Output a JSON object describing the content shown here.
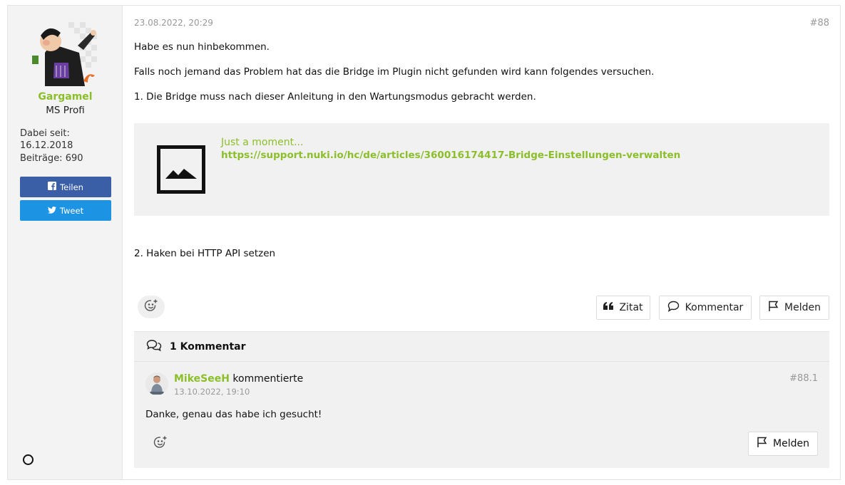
{
  "author": {
    "name": "Gargamel",
    "rank": "MS Profi",
    "member_since_label": "Dabei seit:",
    "member_since_date": "16.12.2018",
    "posts": "Beiträge: 690"
  },
  "share": {
    "facebook_label": "Teilen",
    "twitter_label": "Tweet"
  },
  "post": {
    "date": "23.08.2022, 20:29",
    "number": "#88",
    "para1": "Habe es nun hinbekommen.",
    "para2": "Falls noch jemand das Problem hat das die Bridge im Plugin nicht gefunden wird kann folgendes versuchen.",
    "para3": "1. Die Bridge muss nach dieser Anleitung in den Wartungsmodus gebracht werden.",
    "para4": "2. Haken bei HTTP API setzen"
  },
  "embed": {
    "title": "Just a moment...",
    "url": "https://support.nuki.io/hc/de/articles/360016174417-Bridge-Einstellungen-verwalten",
    "icon": "image-placeholder-icon"
  },
  "actions": {
    "quote": "Zitat",
    "comment": "Kommentar",
    "report": "Melden"
  },
  "comments": {
    "title": "1 Kommentar",
    "items": [
      {
        "author": "MikeSeeH",
        "verb": " kommentierte",
        "date": "13.10.2022, 19:10",
        "number": "#88.1",
        "text": "Danke, genau das habe ich gesucht!",
        "report": "Melden"
      }
    ]
  },
  "colors": {
    "accent": "#8bbf2a",
    "facebook": "#3b5fa6",
    "twitter": "#1d93e4",
    "panel": "#f2f1f1"
  }
}
